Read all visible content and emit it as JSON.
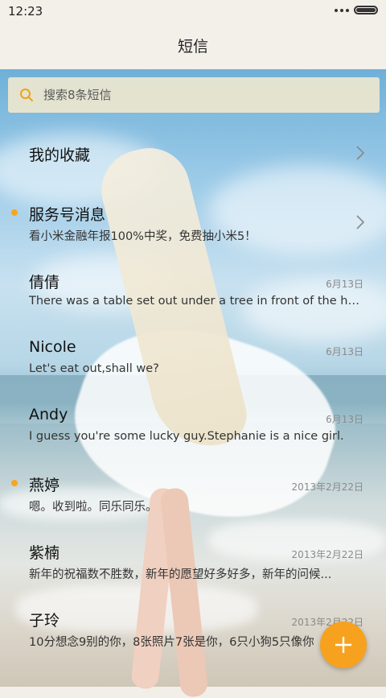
{
  "status": {
    "time": "12:23"
  },
  "header": {
    "title": "短信"
  },
  "search": {
    "placeholder": "搜索8条短信"
  },
  "items": [
    {
      "name": "我的收藏",
      "preview": "",
      "date": "",
      "unread": false,
      "chevron": true
    },
    {
      "name": "服务号消息",
      "preview": "看小米金融年报100%中奖，免费抽小米5！",
      "date": "",
      "unread": true,
      "chevron": true
    },
    {
      "name": "倩倩",
      "preview": "There was a table set out under a tree in front of the ho...",
      "date": "6月13日",
      "unread": false,
      "chevron": false
    },
    {
      "name": "Nicole",
      "preview": "Let's eat out,shall we?",
      "date": "6月13日",
      "unread": false,
      "chevron": false
    },
    {
      "name": "Andy",
      "preview": "I guess you're some lucky guy.Stephanie is a nice girl.",
      "date": "6月13日",
      "unread": false,
      "chevron": false
    },
    {
      "name": "燕婷",
      "preview": "嗯。收到啦。同乐同乐。",
      "date": "2013年2月22日",
      "unread": true,
      "chevron": false
    },
    {
      "name": "紫楠",
      "preview": "新年的祝福数不胜数，新年的愿望好多好多，新年的问候...",
      "date": "2013年2月22日",
      "unread": false,
      "chevron": false
    },
    {
      "name": "子玲",
      "preview": "10分想念9别的你，8张照片7张是你，6只小狗5只像你",
      "date": "2013年2月22日",
      "unread": false,
      "chevron": false
    }
  ],
  "colors": {
    "accent": "#f5a623",
    "fab": "#f6a21e",
    "search_bg": "#eee8ce"
  },
  "icons": {
    "search": "search-icon",
    "chevron": "chevron-right-icon",
    "compose": "plus-icon"
  }
}
